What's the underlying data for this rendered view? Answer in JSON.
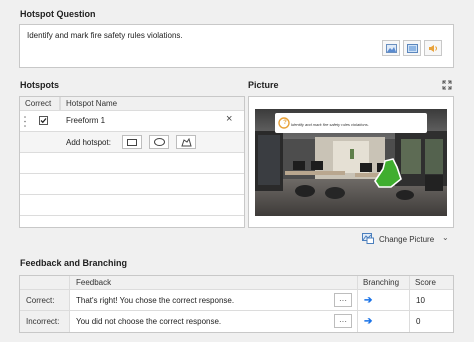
{
  "question": {
    "title": "Hotspot Question",
    "text": "Identify and mark fire safety rules violations.",
    "media_buttons": [
      {
        "icon": "image-icon"
      },
      {
        "icon": "video-icon"
      },
      {
        "icon": "audio-icon"
      }
    ]
  },
  "hotspots": {
    "title": "Hotspots",
    "columns": [
      "Correct",
      "Hotspot Name"
    ],
    "rows": [
      {
        "correct": true,
        "name": "Freeform 1",
        "remove": "×"
      }
    ],
    "add_label": "Add hotspot:"
  },
  "picture": {
    "title": "Picture",
    "banner_text": "Identify and mark fire safety rules violations.",
    "banner_icon": "?",
    "change_label": "Change Picture"
  },
  "feedback": {
    "title": "Feedback and Branching",
    "columns": [
      "Feedback",
      "Branching",
      "Score"
    ],
    "rows": [
      {
        "label": "Correct:",
        "text": "That's right! You chose the correct response.",
        "more": "···",
        "branch": "➔",
        "score": "10"
      },
      {
        "label": "Incorrect:",
        "text": "You did not choose the correct response.",
        "more": "···",
        "branch": "➔",
        "score": "0"
      }
    ]
  },
  "colors": {
    "accent": "#1a73e8",
    "hotspot_fill": "#3fae2f",
    "banner_icon": "#e8a23a"
  }
}
